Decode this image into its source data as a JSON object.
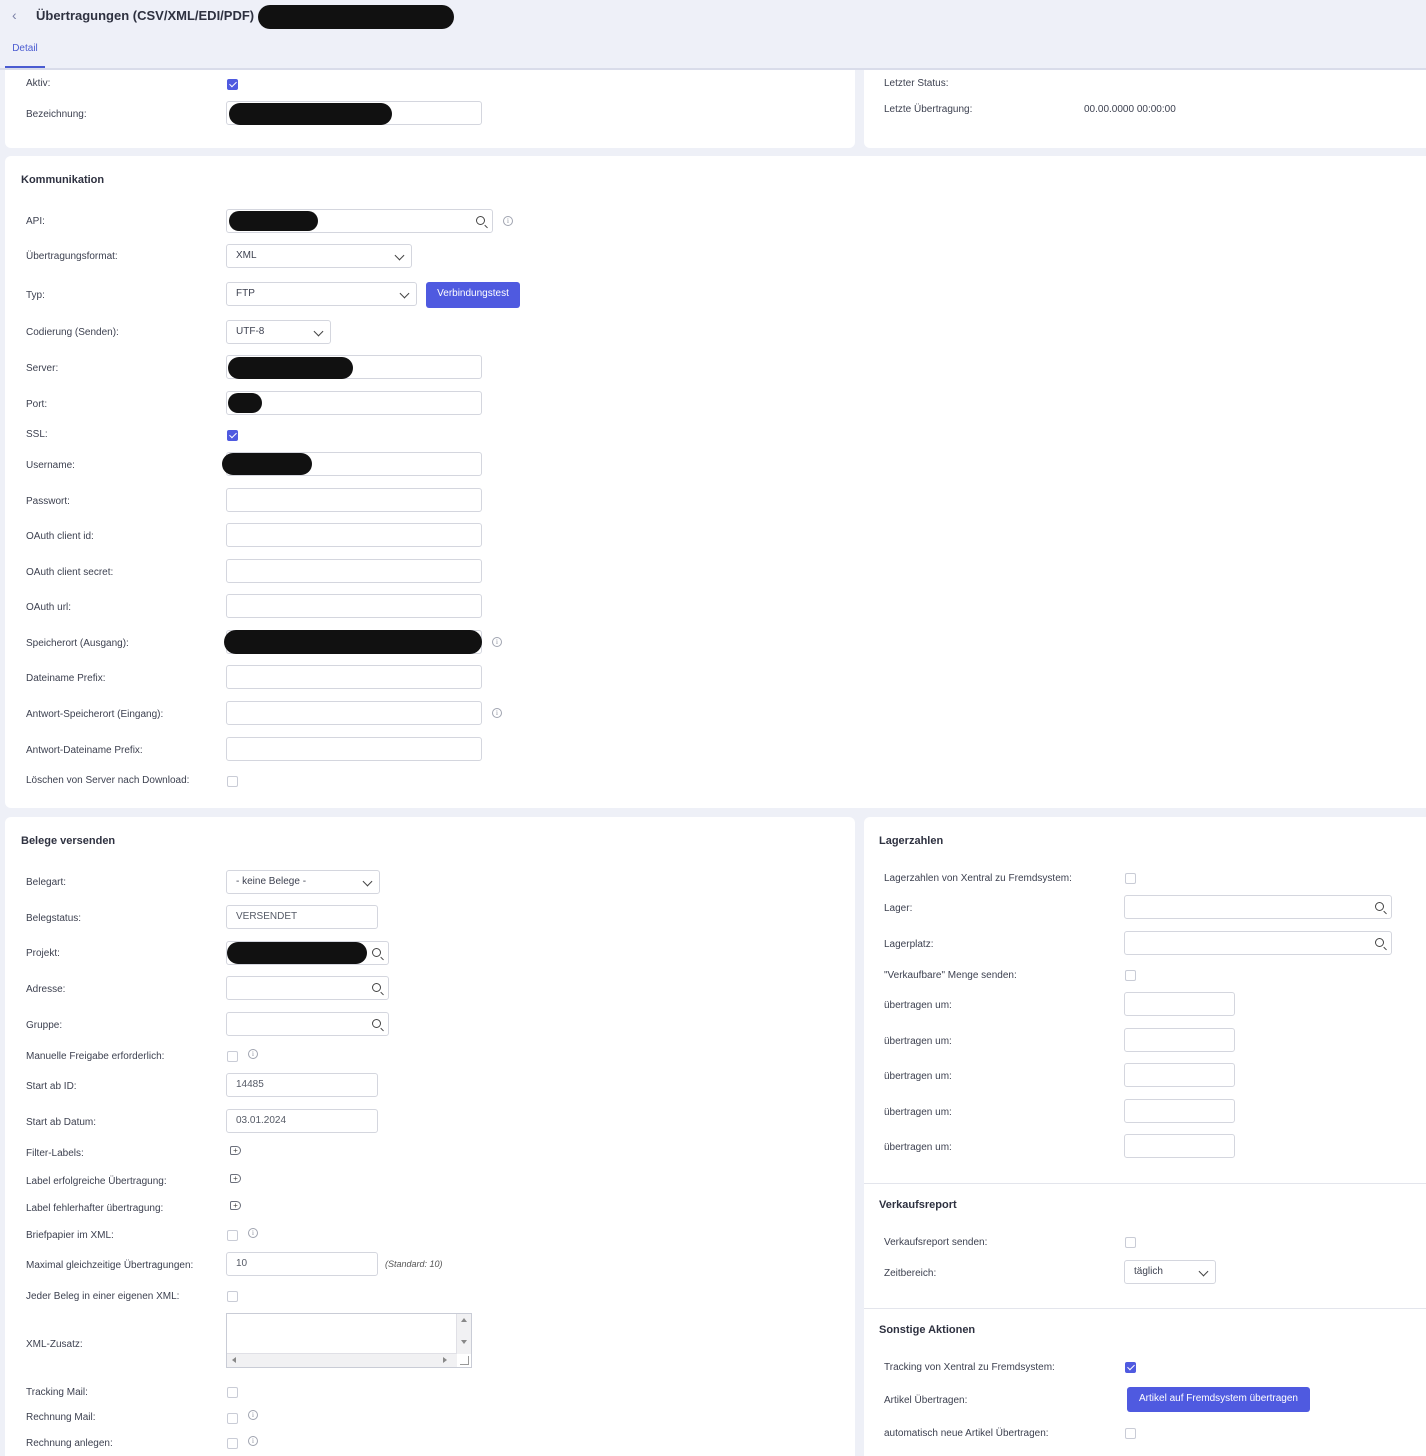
{
  "header": {
    "title": "Übertragungen (CSV/XML/EDI/PDF)",
    "tab_detail": "Detail"
  },
  "general": {
    "aktiv_label": "Aktiv:",
    "bezeichnung_label": "Bezeichnung:",
    "letzter_status_label": "Letzter Status:",
    "letzte_uebertragung_label": "Letzte Übertragung:",
    "letzte_uebertragung_value": "00.00.0000 00:00:00"
  },
  "kommunikation": {
    "heading": "Kommunikation",
    "api_label": "API:",
    "format_label": "Übertragungsformat:",
    "format_value": "XML",
    "typ_label": "Typ:",
    "typ_value": "FTP",
    "verbindungstest_label": "Verbindungstest",
    "codierung_label": "Codierung (Senden):",
    "codierung_value": "UTF-8",
    "server_label": "Server:",
    "port_label": "Port:",
    "ssl_label": "SSL:",
    "username_label": "Username:",
    "passwort_label": "Passwort:",
    "oauth_id_label": "OAuth client id:",
    "oauth_secret_label": "OAuth client secret:",
    "oauth_url_label": "OAuth url:",
    "speicherort_label": "Speicherort (Ausgang):",
    "prefix_label": "Dateiname Prefix:",
    "antwort_speicherort_label": "Antwort-Speicherort (Eingang):",
    "antwort_prefix_label": "Antwort-Dateiname Prefix:",
    "loeschen_label": "Löschen von Server nach Download:"
  },
  "belege": {
    "heading": "Belege versenden",
    "belegart_label": "Belegart:",
    "belegart_value": "- keine Belege -",
    "belegstatus_label": "Belegstatus:",
    "belegstatus_value": "VERSENDET",
    "projekt_label": "Projekt:",
    "adresse_label": "Adresse:",
    "gruppe_label": "Gruppe:",
    "freigabe_label": "Manuelle Freigabe erforderlich:",
    "start_id_label": "Start ab ID:",
    "start_id_value": "14485",
    "start_datum_label": "Start ab Datum:",
    "start_datum_value": "03.01.2024",
    "filter_labels_label": "Filter-Labels:",
    "label_ok_label": "Label erfolgreiche Übertragung:",
    "label_err_label": "Label fehlerhafter übertragung:",
    "briefpapier_label": "Briefpapier im XML:",
    "max_label": "Maximal gleichzeitige Übertragungen:",
    "max_value": "10",
    "max_hint": "(Standard: 10)",
    "eigene_xml_label": "Jeder Beleg in einer eigenen XML:",
    "xml_zusatz_label": "XML-Zusatz:",
    "tracking_mail_label": "Tracking Mail:",
    "rechnung_mail_label": "Rechnung Mail:",
    "rechnung_anlegen_label": "Rechnung anlegen:"
  },
  "lager": {
    "heading": "Lagerzahlen",
    "lagerzahlen_label": "Lagerzahlen von Xentral zu Fremdsystem:",
    "lager_label": "Lager:",
    "lagerplatz_label": "Lagerplatz:",
    "verkaufbare_label": "\"Verkaufbare\" Menge senden:",
    "uebertragen_labels": [
      "übertragen um:",
      "übertragen um:",
      "übertragen um:",
      "übertragen um:",
      "übertragen um:"
    ]
  },
  "verkaufsreport": {
    "heading": "Verkaufsreport",
    "senden_label": "Verkaufsreport senden:",
    "zeitbereich_label": "Zeitbereich:",
    "zeitbereich_value": "täglich"
  },
  "sonstige": {
    "heading": "Sonstige Aktionen",
    "tracking_label": "Tracking von Xentral zu Fremdsystem:",
    "artikel_label": "Artikel Übertragen:",
    "artikel_button": "Artikel auf Fremdsystem übertragen",
    "auto_label": "automatisch neue Artikel Übertragen:"
  }
}
